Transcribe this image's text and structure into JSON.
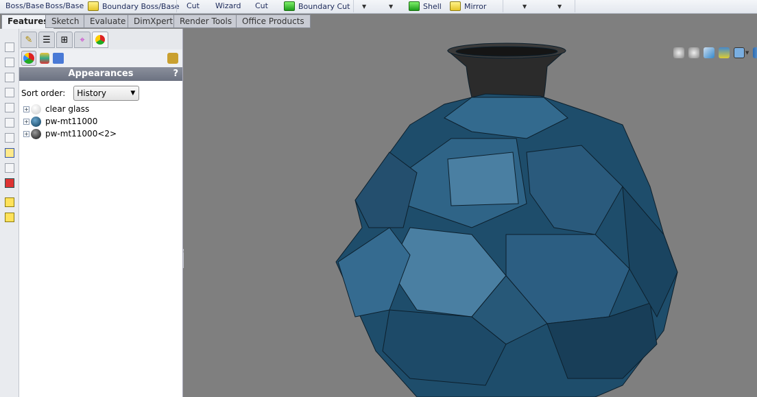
{
  "ribbon": {
    "partial_labels": [
      "Boss/Base",
      "Boss/Base",
      "Cut",
      "Wizard",
      "Cut"
    ],
    "boundary_boss": "Boundary Boss/Base",
    "boundary_cut": "Boundary Cut",
    "shell": "Shell",
    "mirror": "Mirror"
  },
  "tabs": [
    "Features",
    "Sketch",
    "Evaluate",
    "DimXpert",
    "Render Tools",
    "Office Products"
  ],
  "panel": {
    "title": "Appearances",
    "help": "?",
    "sort_label": "Sort order:",
    "sort_value": "History",
    "items": [
      {
        "label": "clear glass",
        "color": "#f2f2f2"
      },
      {
        "label": "pw-mt11000",
        "color": "#1e5577"
      },
      {
        "label": "pw-mt11000<2>",
        "color": "#2a2a2a"
      }
    ]
  },
  "viewport": {
    "background": "#7f7f7f",
    "model_color": "#2f6285"
  },
  "view_tools": [
    "zoom-to-fit-icon",
    "zoom-to-area-icon",
    "previous-view-icon",
    "section-view-icon",
    "view-orientation-icon",
    "display-style-icon",
    "hide-show-icon",
    "edit-appearance-icon",
    "apply-scene-icon",
    "view-settings-icon"
  ]
}
